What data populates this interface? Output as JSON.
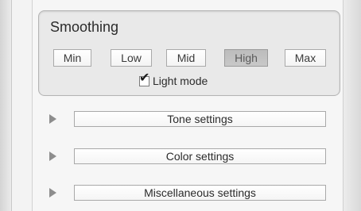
{
  "smoothing": {
    "title": "Smoothing",
    "options": [
      "Min",
      "Low",
      "Mid",
      "High",
      "Max"
    ],
    "selected": "High",
    "light_mode": {
      "label": "Light mode",
      "checked": true
    }
  },
  "sections": [
    {
      "label": "Tone settings",
      "icon": "disclosure-triangle-icon",
      "expanded": false
    },
    {
      "label": "Color settings",
      "icon": "disclosure-triangle-icon",
      "expanded": false
    },
    {
      "label": "Miscellaneous settings",
      "icon": "disclosure-triangle-icon",
      "expanded": false
    }
  ]
}
